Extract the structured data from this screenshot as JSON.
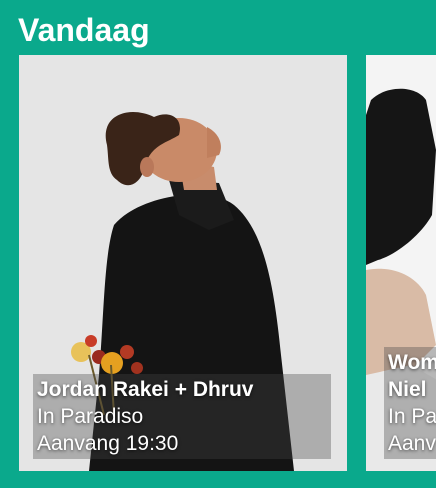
{
  "section": {
    "title": "Vandaag"
  },
  "events": [
    {
      "title": "Jordan Rakei + Dhruv",
      "venue": "In Paradiso",
      "start": "Aanvang 19:30"
    },
    {
      "title_line1": "Wom",
      "title_line2": "Niel",
      "venue": "In Pa",
      "start": "Aanv"
    }
  ],
  "colors": {
    "background": "#0aa98c",
    "caption_text": "#ffffff"
  }
}
